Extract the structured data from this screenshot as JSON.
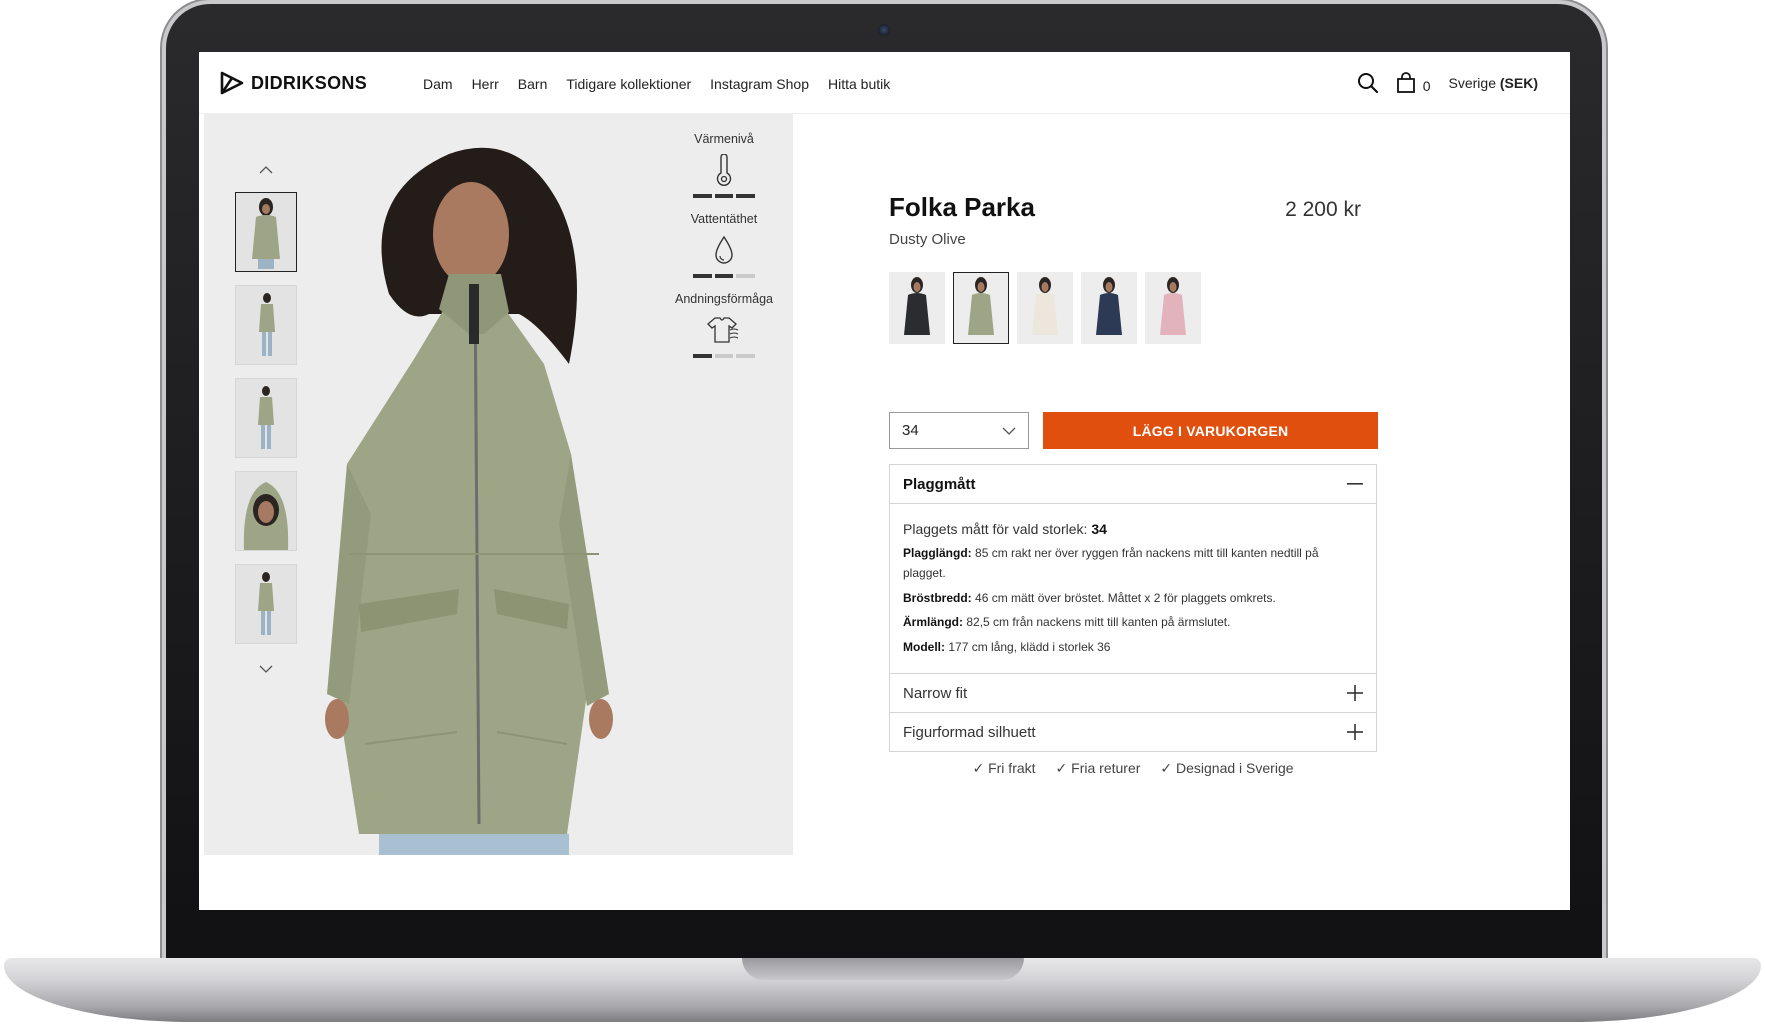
{
  "brand": {
    "name": "DIDRIKSONS"
  },
  "nav": {
    "items": [
      "Dam",
      "Herr",
      "Barn",
      "Tidigare kollektioner",
      "Instagram Shop",
      "Hitta butik"
    ]
  },
  "header": {
    "cart_count": "0",
    "locale_country": "Sverige",
    "locale_currency": "(SEK)",
    "icons": [
      "search-icon",
      "bag-icon"
    ]
  },
  "features": [
    {
      "label": "Värmenivå",
      "icon": "thermometer-icon",
      "level": 3,
      "max": 3
    },
    {
      "label": "Vattentäthet",
      "icon": "water-drop-icon",
      "level": 2,
      "max": 3
    },
    {
      "label": "Andningsförmåga",
      "icon": "breathable-shirt-icon",
      "level": 1,
      "max": 3
    }
  ],
  "product": {
    "title": "Folka Parka",
    "price": "2 200 kr",
    "color": "Dusty Olive",
    "swatch_colors": [
      "#2b2c30",
      "#9ea586",
      "#ece6dc",
      "#2d3a55",
      "#e2b3bb"
    ],
    "active_swatch": 1
  },
  "size": {
    "value": "34"
  },
  "cta": {
    "add_to_cart": "LÄGG I VARUKORGEN"
  },
  "measurements": {
    "title": "Plaggmått",
    "lead_label": "Plaggets mått för vald storlek:",
    "lead_value": "34",
    "rows": [
      {
        "label": "Plagglängd:",
        "text": "85 cm rakt ner över ryggen från nackens mitt till kanten nedtill på plagget."
      },
      {
        "label": "Bröstbredd:",
        "text": "46 cm mätt över bröstet. Måttet x 2 för plaggets omkrets."
      },
      {
        "label": "Ärmlängd:",
        "text": "82,5 cm från nackens mitt till kanten på ärmslutet."
      },
      {
        "label": "Modell:",
        "text": "177 cm lång, klädd i storlek 36"
      }
    ]
  },
  "accordion_rows": [
    "Narrow fit",
    "Figurformad silhuett"
  ],
  "usps": [
    "✓ Fri frakt",
    "✓ Fria returer",
    "✓ Designad i Sverige"
  ]
}
